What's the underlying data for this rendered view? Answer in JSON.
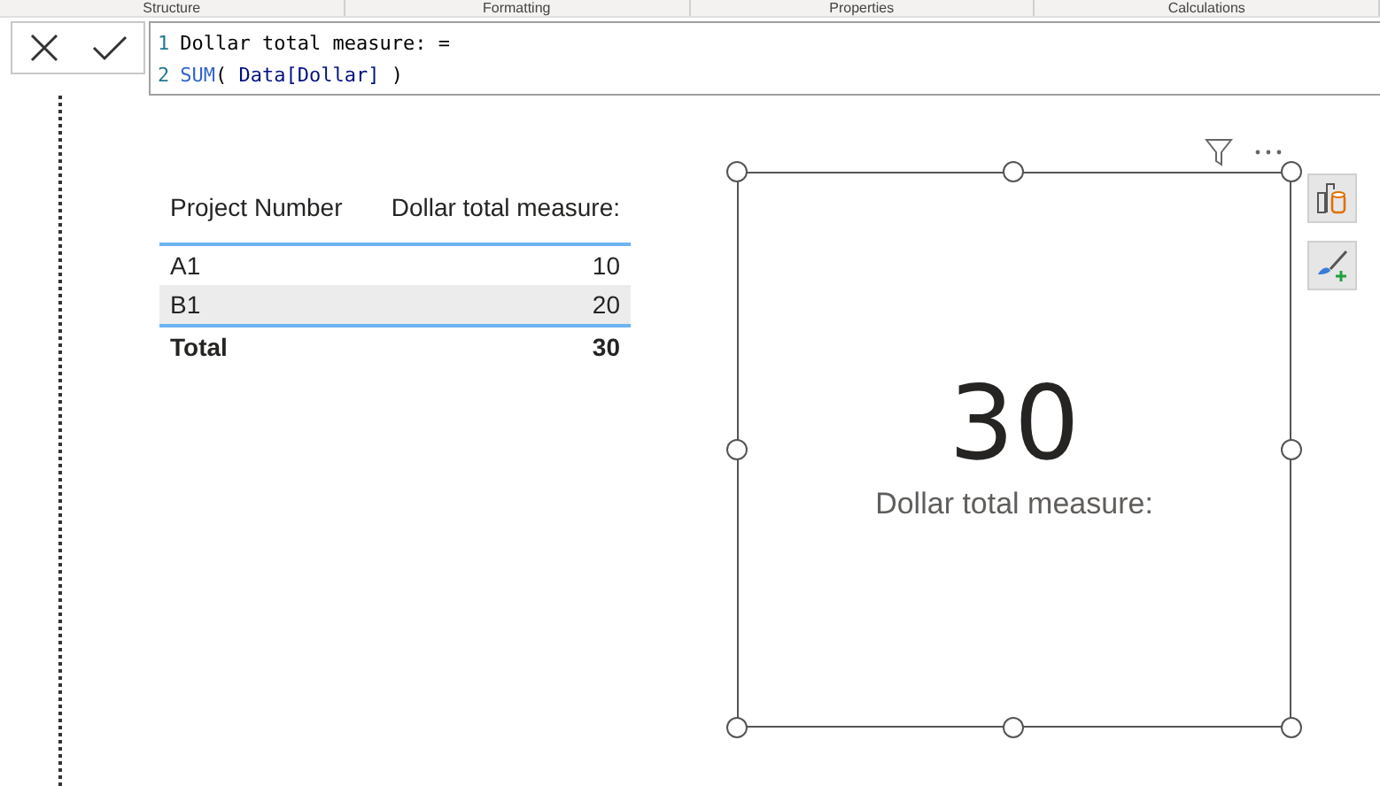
{
  "ribbon_tabs": [
    {
      "label": "Structure"
    },
    {
      "label": "Formatting"
    },
    {
      "label": "Properties"
    },
    {
      "label": "Calculations"
    }
  ],
  "formula_bar": {
    "lines": [
      {
        "number": "1",
        "tokens": [
          {
            "text": "Dollar total measure: =",
            "kind": "plain"
          }
        ]
      },
      {
        "number": "2",
        "tokens": [
          {
            "text": "SUM",
            "kind": "function"
          },
          {
            "text": "( ",
            "kind": "plain"
          },
          {
            "text": "Data[Dollar]",
            "kind": "column"
          },
          {
            "text": " )",
            "kind": "plain"
          }
        ]
      }
    ]
  },
  "table": {
    "columns": [
      "Project Number",
      "Dollar total measure:"
    ],
    "rows": [
      {
        "kind": "data",
        "cells": [
          "A1",
          "10"
        ],
        "shaded": false
      },
      {
        "kind": "data",
        "cells": [
          "B1",
          "20"
        ],
        "shaded": true
      },
      {
        "kind": "total",
        "cells": [
          "Total",
          "30"
        ],
        "shaded": false
      }
    ]
  },
  "card": {
    "value": "30",
    "label": "Dollar total measure:"
  }
}
